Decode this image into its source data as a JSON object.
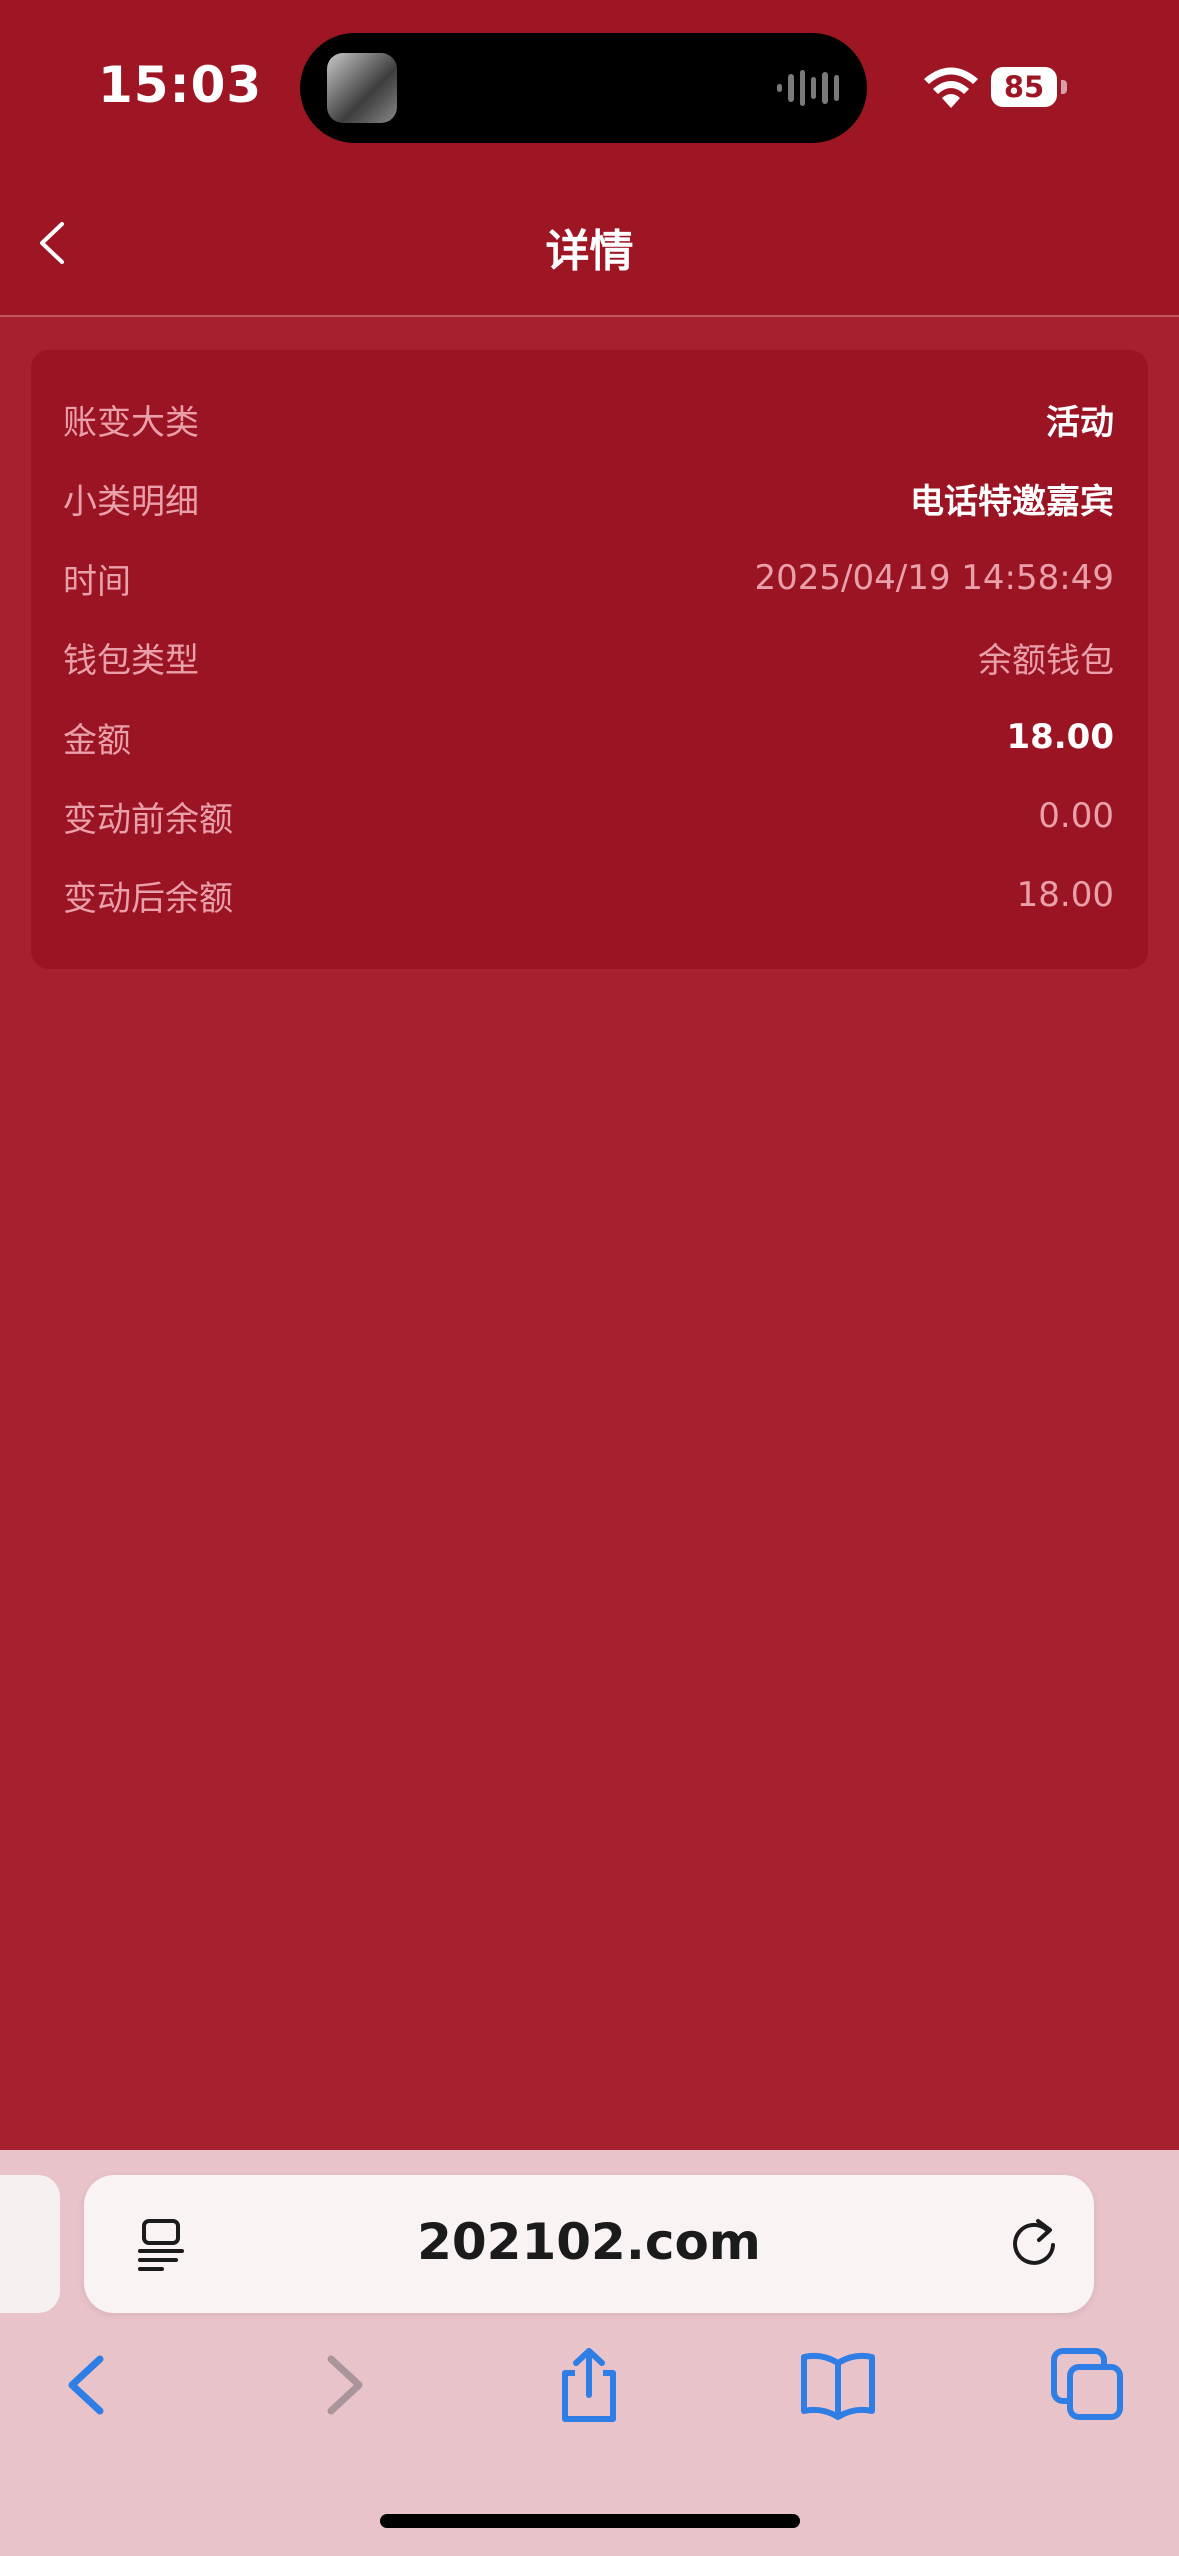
{
  "status_bar": {
    "time": "15:03",
    "battery": "85"
  },
  "header": {
    "title": "详情"
  },
  "details": [
    {
      "label": "账变大类",
      "value": "活动",
      "bold": true
    },
    {
      "label": "小类明细",
      "value": "电话特邀嘉宾",
      "bold": true
    },
    {
      "label": "时间",
      "value": "2025/04/19 14:58:49",
      "bold": false
    },
    {
      "label": "钱包类型",
      "value": "余额钱包",
      "bold": false
    },
    {
      "label": "金额",
      "value": "18.00",
      "bold": true
    },
    {
      "label": "变动前余额",
      "value": "0.00",
      "bold": false
    },
    {
      "label": "变动后余额",
      "value": "18.00",
      "bold": false
    }
  ],
  "browser": {
    "url": "202102.com"
  },
  "colors": {
    "background": "#a6202f",
    "header": "#9e1624",
    "card": "#9b1423",
    "label": "#eaa0aa",
    "toolbar_accent": "#2f7ee6"
  }
}
